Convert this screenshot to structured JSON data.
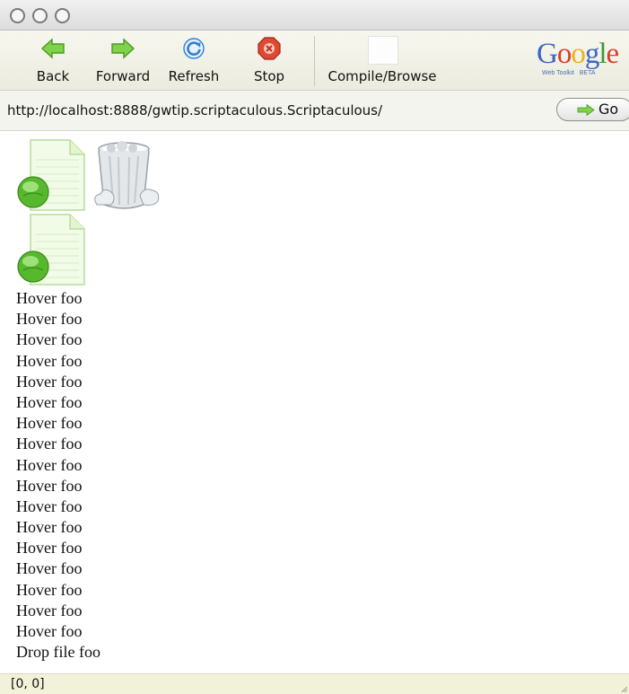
{
  "window": {
    "controls": [
      "close",
      "minimize",
      "zoom"
    ]
  },
  "toolbar": {
    "back_label": "Back",
    "forward_label": "Forward",
    "refresh_label": "Refresh",
    "stop_label": "Stop",
    "compile_label": "Compile/Browse",
    "logo": {
      "word": "Google",
      "sub": "Web Toolkit",
      "badge": "BETA"
    }
  },
  "address": {
    "url": "http://localhost:8888/gwtip.scriptaculous.Scriptaculous/",
    "go_label": "Go"
  },
  "content": {
    "icons": [
      "document-icon",
      "trash-icon",
      "document-icon"
    ],
    "hover_items": [
      "Hover foo",
      "Hover foo",
      "Hover foo",
      "Hover foo",
      "Hover foo",
      "Hover foo",
      "Hover foo",
      "Hover foo",
      "Hover foo",
      "Hover foo",
      "Hover foo",
      "Hover foo",
      "Hover foo",
      "Hover foo",
      "Hover foo",
      "Hover foo",
      "Hover foo"
    ],
    "drop_item": "Drop file foo"
  },
  "status": {
    "text": "[0, 0]"
  },
  "colors": {
    "arrow_green": "#6cc33a",
    "refresh_blue": "#2f7fd6",
    "stop_red": "#d8402c",
    "status_bg": "#f2f1d9"
  }
}
